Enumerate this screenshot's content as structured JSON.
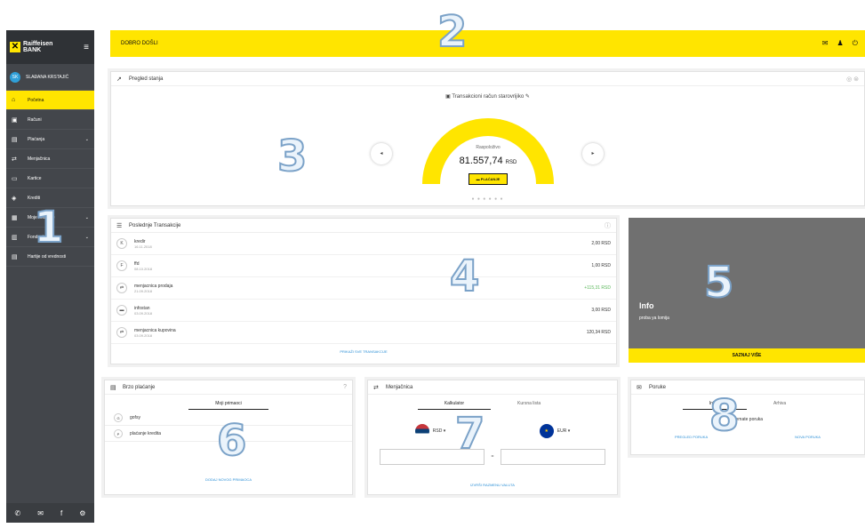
{
  "brand": {
    "name": "Raiffeisen",
    "sub": "BANK",
    "accent": "#ffe500"
  },
  "user": {
    "initials": "SK",
    "name": "SLAĐANA KRSTAJIĆ"
  },
  "nav": [
    {
      "label": "Početna",
      "icon": "home-icon",
      "glyph": "⌂",
      "active": true,
      "chev": ""
    },
    {
      "label": "Računi",
      "icon": "accounts-icon",
      "glyph": "▣",
      "chev": ""
    },
    {
      "label": "Plaćanja",
      "icon": "payment-icon",
      "glyph": "▤",
      "chev": "⌄"
    },
    {
      "label": "Menjačnica",
      "icon": "exchange-icon",
      "glyph": "⇄",
      "chev": ""
    },
    {
      "label": "Kartice",
      "icon": "card-icon",
      "glyph": "▭",
      "chev": ""
    },
    {
      "label": "Krediti",
      "icon": "credit-icon",
      "glyph": "◈",
      "chev": ""
    },
    {
      "label": "Moje finansije",
      "icon": "finance-icon",
      "glyph": "▦",
      "chev": "⌄"
    },
    {
      "label": "Fondovi",
      "icon": "funds-icon",
      "glyph": "▥",
      "chev": "⌄"
    },
    {
      "label": "Hartije od vrednosti",
      "icon": "securities-icon",
      "glyph": "▤",
      "chev": ""
    }
  ],
  "footer_icons": [
    "phone-icon",
    "mail-icon",
    "facebook-icon",
    "settings-icon"
  ],
  "topbar": {
    "welcome": "DOBRO DOŠLI"
  },
  "overview": {
    "title": "Pregled stanja",
    "account": "Transakcioni račun starovrijiko",
    "available_label": "Raspoloživo",
    "amount": "81.557,74",
    "currency": "RSD",
    "pay_label": "PLAĆANJE",
    "gauge_fraction": 1.0
  },
  "transactions": {
    "title": "Poslednje Transakcije",
    "rows": [
      {
        "icon": "K",
        "name": "kredir",
        "date": "16.11.2018",
        "amount": "2,00 RSD",
        "positive": false
      },
      {
        "icon": "F",
        "name": "ffd",
        "date": "08.10.2018",
        "amount": "1,00 RSD",
        "positive": false
      },
      {
        "icon": "⇄",
        "name": "menjacnica prodaja",
        "date": "21.09.2018",
        "amount": "+115,31 RSD",
        "positive": true
      },
      {
        "icon": "▬",
        "name": "infostan",
        "date": "03.09.2018",
        "amount": "3,00 RSD",
        "positive": false
      },
      {
        "icon": "⇄",
        "name": "menjacnica kupovina",
        "date": "03.09.2018",
        "amount": "120,34 RSD",
        "positive": false
      }
    ],
    "footer": "PRIKAŽI SVE TRANSAKCIJE"
  },
  "info": {
    "title": "Info",
    "subtitle": "proba ya lomija",
    "button": "SAZNAJ VIŠE"
  },
  "quickpay": {
    "title": "Brzo plaćanje",
    "tab": "Moji primaoci",
    "rows": [
      {
        "icon": "G",
        "label": "gofsy"
      },
      {
        "icon": "P",
        "label": "plaćanje kredita"
      }
    ],
    "footer": "DODAJ NOVOG PRIMAOCA"
  },
  "exchange": {
    "title": "Menjačnica",
    "tabs": [
      "Kalkulator",
      "Kursna lista"
    ],
    "from": "RSD ▾",
    "to": "EUR ▾",
    "eq": "=",
    "footer": "IZVRŠI RAZMENU VALUTA"
  },
  "messages": {
    "title": "Poruke",
    "tabs": [
      "Inbox",
      "Arhiva"
    ],
    "empty": "Nemate poruka",
    "link1": "PREGLED PORUKA",
    "link2": "NOVA PORUKA"
  },
  "labels": {
    "n1": "1",
    "n2": "2",
    "n3": "3",
    "n4": "4",
    "n5": "5",
    "n6": "6",
    "n7": "7",
    "n8": "8"
  }
}
